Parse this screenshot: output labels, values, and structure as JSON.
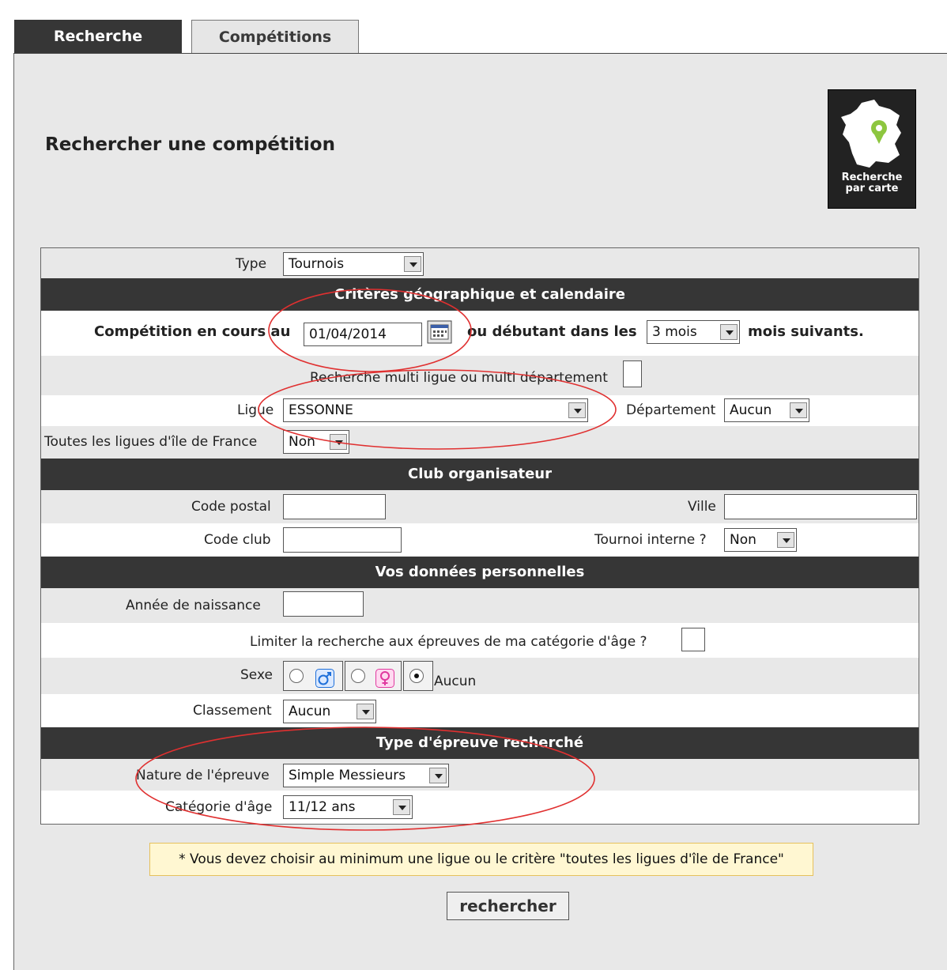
{
  "tabs": [
    "Recherche",
    "Compétitions"
  ],
  "title": "Rechercher une compétition",
  "map_button": {
    "line1": "Recherche",
    "line2": "par carte",
    "icon": "france-map-pin-icon"
  },
  "form": {
    "type_label": "Type",
    "type_value": "Tournois",
    "section_geo": "Critères géographique et calendaire",
    "comp_label": "Compétition en cours au",
    "comp_date": "01/04/2014",
    "comp_mid": "ou débutant dans les",
    "months_value": "3 mois",
    "comp_suffix": "mois suivants.",
    "multi_label": "Recherche multi ligue ou multi département",
    "ligue_label": "Ligue",
    "ligue_value": "ESSONNE",
    "dept_label": "Département",
    "dept_value": "Aucun",
    "idf_label": "Toutes les ligues d'île de France",
    "idf_value": "Non",
    "section_club": "Club organisateur",
    "cp_label": "Code postal",
    "ville_label": "Ville",
    "codeclub_label": "Code club",
    "interne_label": "Tournoi interne ?",
    "interne_value": "Non",
    "section_perso": "Vos données personnelles",
    "annee_label": "Année de naissance",
    "limiter_label": "Limiter la recherche aux épreuves de ma catégorie d'âge ?",
    "sexe_label": "Sexe",
    "sexe_none": "Aucun",
    "classement_label": "Classement",
    "classement_value": "Aucun",
    "section_epreuve": "Type d'épreuve recherché",
    "nature_label": "Nature de l'épreuve",
    "nature_value": "Simple Messieurs",
    "categorie_label": "Catégorie d'âge",
    "categorie_value": "11/12 ans"
  },
  "note": "* Vous devez choisir au minimum une ligue ou le critère \"toutes les ligues d'île de France\"",
  "submit": "rechercher",
  "colors": {
    "dark_bar": "#363636",
    "panel": "#e8e8e8",
    "annotation": "#e03030",
    "male": "#1e6fd9",
    "female": "#e0399f"
  }
}
